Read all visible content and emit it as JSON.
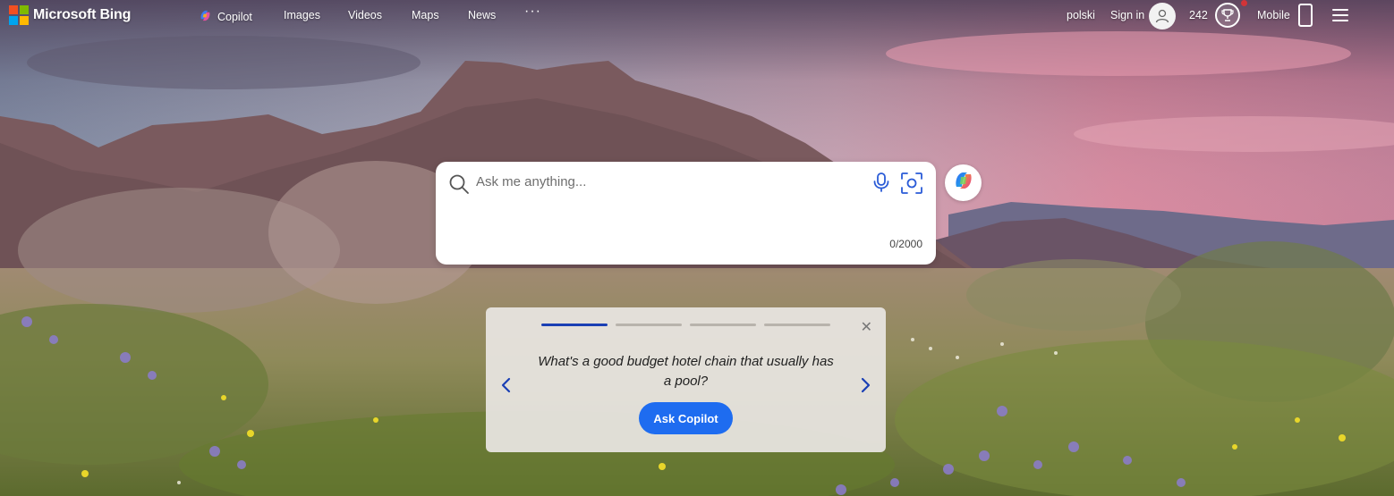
{
  "brand": {
    "name": "Microsoft Bing",
    "logo_colors": [
      "#f25022",
      "#7fba00",
      "#00a4ef",
      "#ffb900"
    ]
  },
  "nav": [
    {
      "label": "Copilot",
      "icon": "copilot-icon"
    },
    {
      "label": "Images"
    },
    {
      "label": "Videos"
    },
    {
      "label": "Maps"
    },
    {
      "label": "News"
    }
  ],
  "nav_more": "···",
  "header_right": {
    "language": "polski",
    "sign_in": "Sign in",
    "points": "242",
    "mobile": "Mobile"
  },
  "search": {
    "placeholder": "Ask me anything...",
    "counter": "0/2000"
  },
  "suggestion": {
    "question": "What's a good budget hotel chain that usually has a pool?",
    "button": "Ask Copilot",
    "active_step": 1,
    "steps": 4
  },
  "colors": {
    "accent": "#1e6cf0",
    "progress_active": "#1a3fb4"
  }
}
